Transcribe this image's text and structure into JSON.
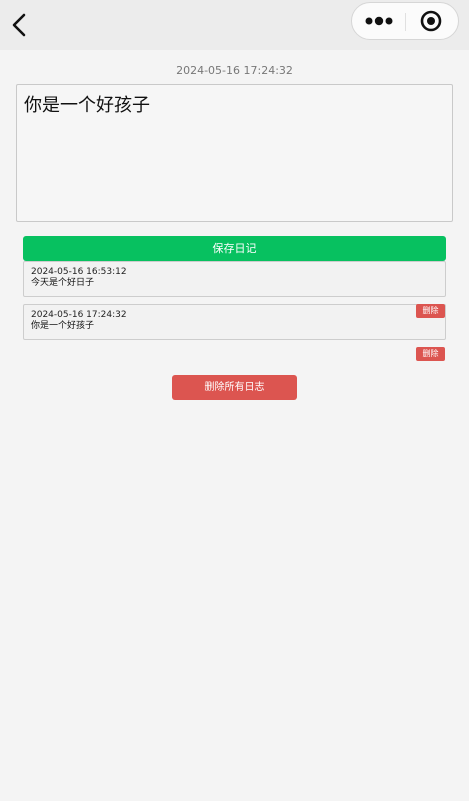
{
  "header": {
    "back_icon": "chevron-left-icon",
    "more_icon": "more-dots-icon",
    "close_icon": "target-circle-icon"
  },
  "page": {
    "current_time": "2024-05-16 17:24:32",
    "editor_text": "你是一个好孩子",
    "save_label": "保存日记",
    "delete_all_label": "删除所有日志"
  },
  "entries": [
    {
      "date": "2024-05-16 16:53:12",
      "text": "今天是个好日子"
    },
    {
      "date": "2024-05-16 17:24:32",
      "text": "你是一个好孩子",
      "delete_label": "删除"
    }
  ],
  "extra_delete_label": "删除",
  "colors": {
    "save": "#07c160",
    "danger": "#dc5550",
    "background": "#f4f4f4"
  }
}
